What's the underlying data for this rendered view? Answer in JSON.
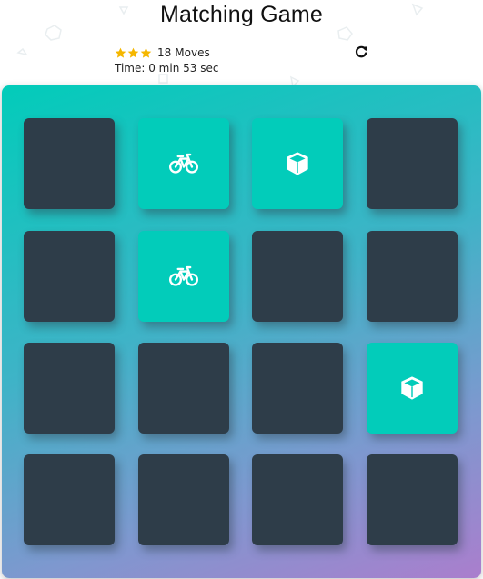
{
  "game": {
    "title": "Matching Game"
  },
  "score": {
    "stars_count": 3,
    "star_color": "#f5b700",
    "moves_value": "18",
    "moves_label": "Moves",
    "timer_text": "Time: 0 min 53 sec"
  },
  "restart": {
    "icon": "restart-icon"
  },
  "colors": {
    "card_closed": "#2e3d49",
    "card_open": "#02ccba",
    "deck_gradient_start": "#02ccba",
    "deck_gradient_end": "#aa7ecd"
  },
  "deck": {
    "cards": [
      {
        "state": "closed",
        "symbol": ""
      },
      {
        "state": "open",
        "symbol": "bicycle-icon"
      },
      {
        "state": "open",
        "symbol": "cube-icon"
      },
      {
        "state": "closed",
        "symbol": ""
      },
      {
        "state": "closed",
        "symbol": ""
      },
      {
        "state": "open",
        "symbol": "bicycle-icon"
      },
      {
        "state": "closed",
        "symbol": ""
      },
      {
        "state": "closed",
        "symbol": ""
      },
      {
        "state": "closed",
        "symbol": ""
      },
      {
        "state": "closed",
        "symbol": ""
      },
      {
        "state": "closed",
        "symbol": ""
      },
      {
        "state": "open",
        "symbol": "cube-icon"
      },
      {
        "state": "closed",
        "symbol": ""
      },
      {
        "state": "closed",
        "symbol": ""
      },
      {
        "state": "closed",
        "symbol": ""
      },
      {
        "state": "closed",
        "symbol": ""
      }
    ]
  }
}
